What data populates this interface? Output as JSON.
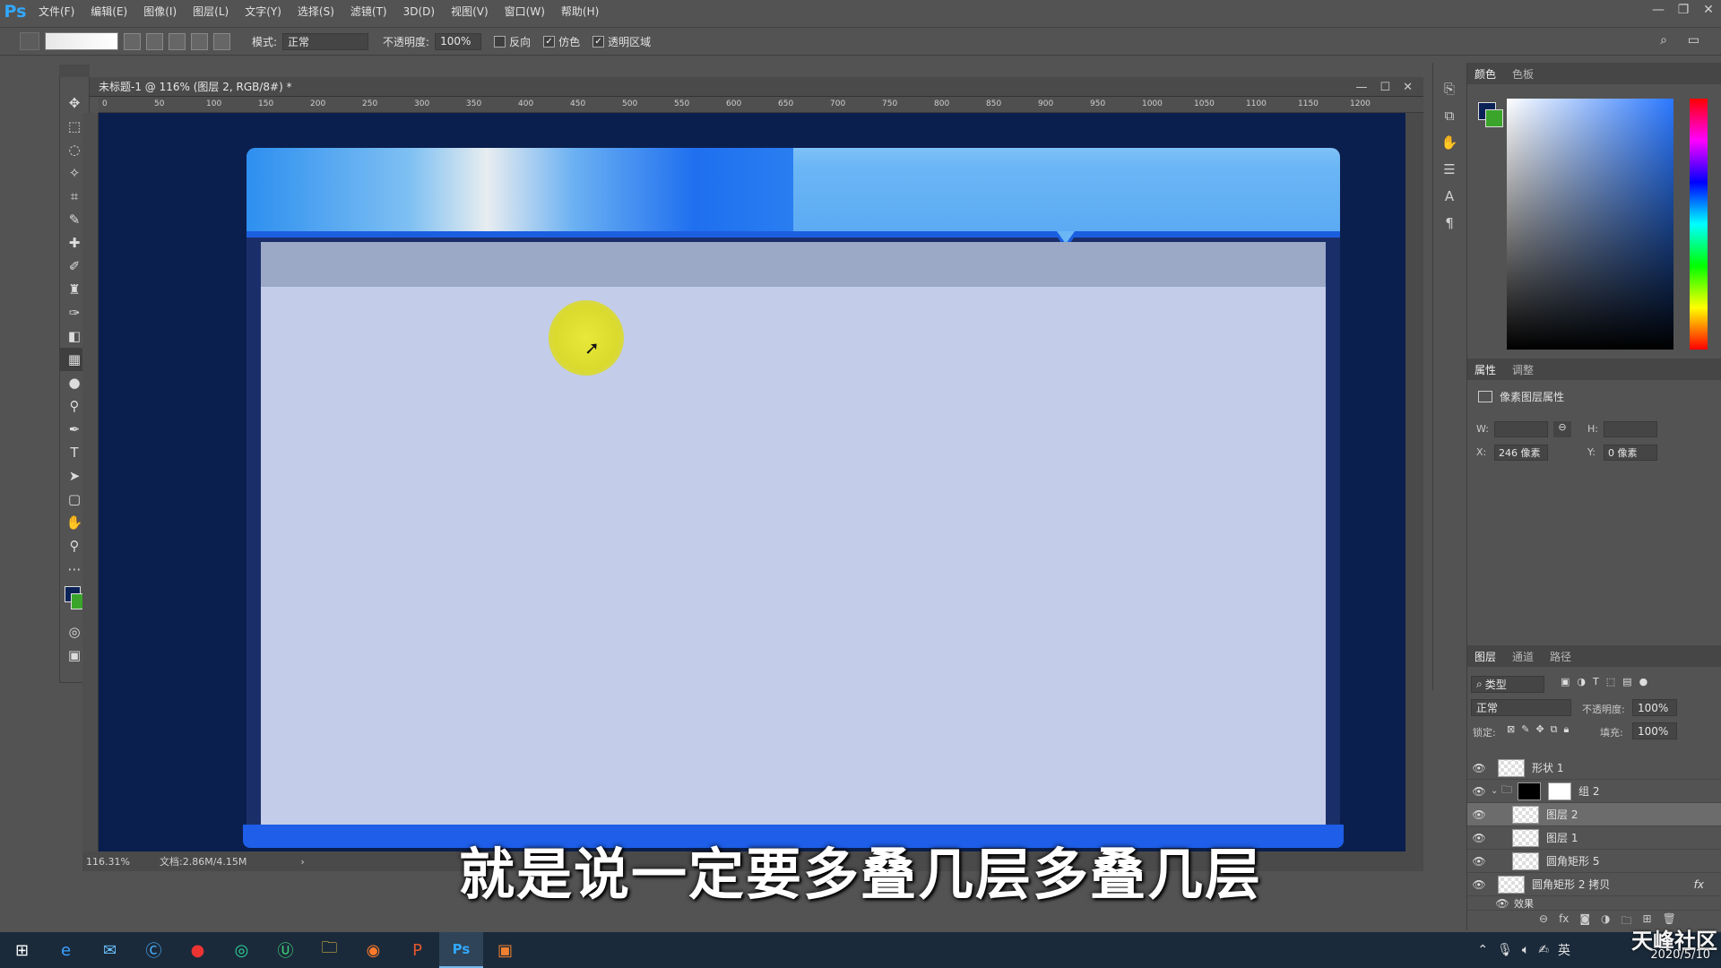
{
  "app": {
    "logo": "Ps",
    "menu": [
      "文件(F)",
      "编辑(E)",
      "图像(I)",
      "图层(L)",
      "文字(Y)",
      "选择(S)",
      "滤镜(T)",
      "3D(D)",
      "视图(V)",
      "窗口(W)",
      "帮助(H)"
    ]
  },
  "options": {
    "mode_label": "模式:",
    "mode_value": "正常",
    "opacity_label": "不透明度:",
    "opacity_value": "100%",
    "reverse_label": "反向",
    "reverse_checked": false,
    "dither_label": "仿色",
    "dither_checked": true,
    "transparency_label": "透明区域",
    "transparency_checked": true
  },
  "document": {
    "title": "未标题-1 @ 116% (图层 2, RGB/8#) *",
    "zoom": "116.31%",
    "doc_size": "文档:2.86M/4.15M",
    "ruler_ticks": [
      "0",
      "50",
      "100",
      "150",
      "200",
      "250",
      "300",
      "350",
      "400",
      "450",
      "500",
      "550",
      "600",
      "650",
      "700",
      "750",
      "800",
      "850",
      "900",
      "950",
      "1000",
      "1050",
      "1100",
      "1150",
      "1200"
    ]
  },
  "colors": {
    "canvas_bg": "#0b1f4e",
    "accent_blue": "#1b5fe0",
    "body_panel": "#c3cce8",
    "fg_color": "#0b2257",
    "bg_color": "#3aa52a"
  },
  "color_panel": {
    "tabs": [
      "颜色",
      "色板"
    ]
  },
  "properties_panel": {
    "tabs": [
      "属性",
      "调整"
    ],
    "section_title": "像素图层属性",
    "w_label": "W:",
    "h_label": "H:",
    "x_label": "X:",
    "x_value": "246 像素",
    "y_label": "Y:",
    "y_value": "0 像素"
  },
  "layers_panel": {
    "tabs": [
      "图层",
      "通道",
      "路径"
    ],
    "filter_label": "类型",
    "blend_mode": "正常",
    "opacity_label": "不透明度:",
    "opacity_value": "100%",
    "lock_label": "锁定:",
    "fill_label": "填充:",
    "fill_value": "100%",
    "layers": [
      {
        "name": "形状 1",
        "selected": false
      },
      {
        "name": "组 2",
        "selected": false
      },
      {
        "name": "图层 2",
        "selected": true
      },
      {
        "name": "图层 1",
        "selected": false
      },
      {
        "name": "圆角矩形 5",
        "selected": false
      },
      {
        "name": "圆角矩形 2 拷贝",
        "selected": false
      }
    ],
    "effects_label": "效果"
  },
  "subtitle": "就是说一定要多叠几层多叠几层",
  "watermark": {
    "brand": "天峰社区",
    "date": "2020/5/10"
  }
}
